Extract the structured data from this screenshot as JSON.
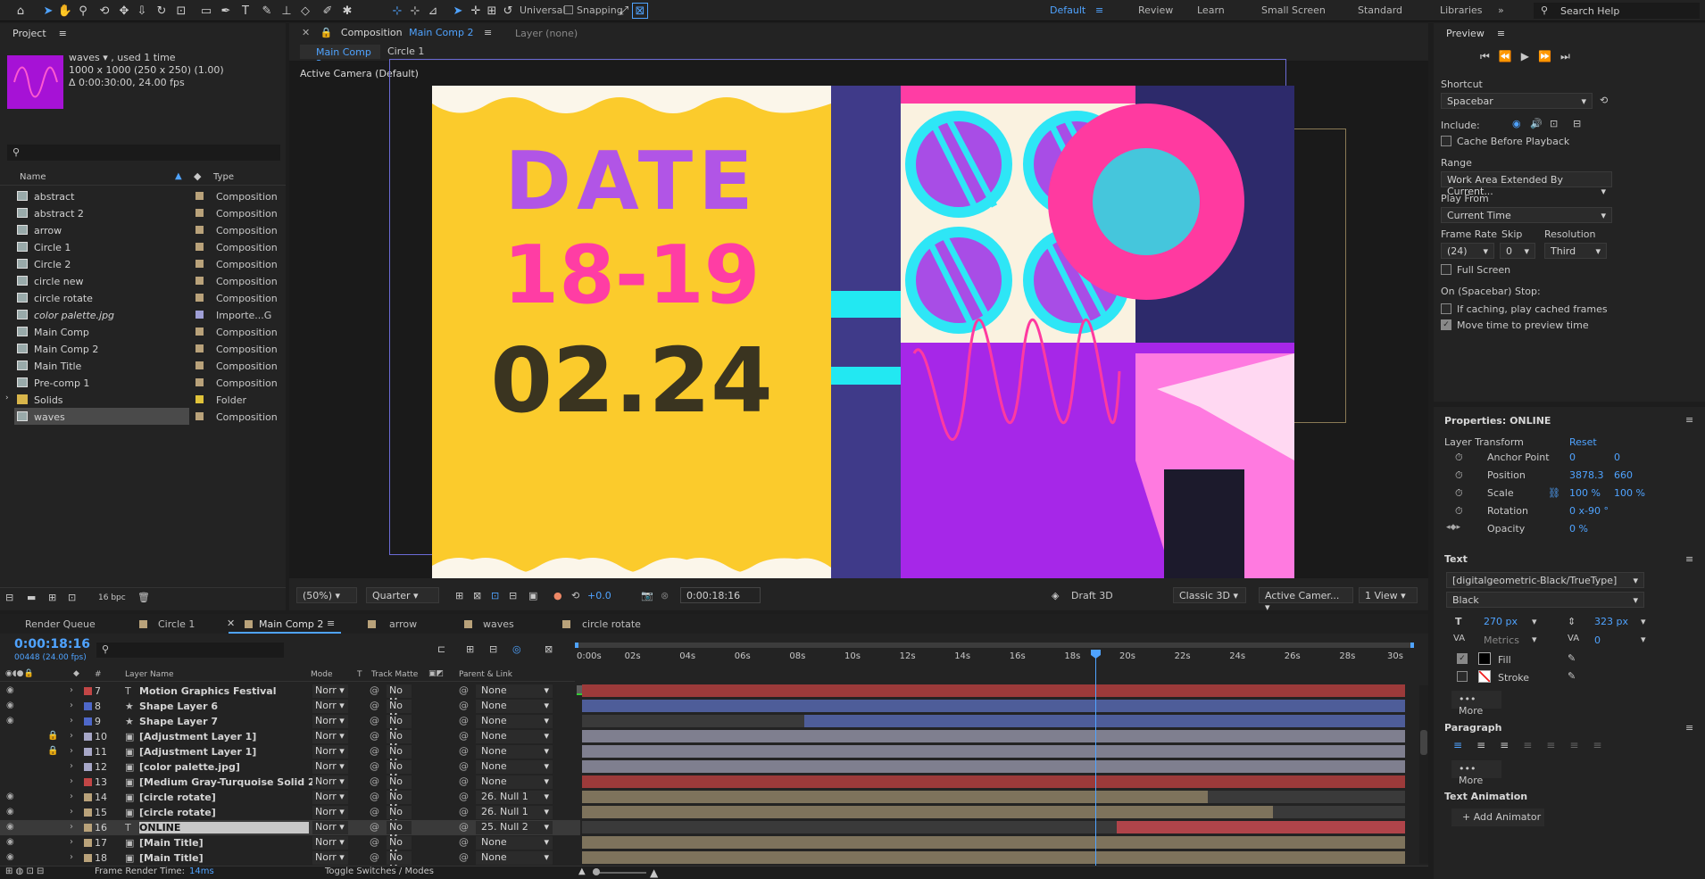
{
  "toolbar": {
    "universal": "Universal",
    "snapping": "Snapping"
  },
  "workspaces": {
    "default": "Default",
    "review": "Review",
    "learn": "Learn",
    "small_screen": "Small Screen",
    "standard": "Standard",
    "libraries": "Libraries",
    "search": "Search Help"
  },
  "project": {
    "title": "Project",
    "item_name": "waves ▾ , used 1 time",
    "item_dims": "1000 x 1000  (250 x 250) (1.00)",
    "item_dur": "Δ 0:00:30:00, 24.00 fps",
    "col_name": "Name",
    "col_type": "Type",
    "items": [
      {
        "name": "abstract",
        "type": "Composition"
      },
      {
        "name": "abstract 2",
        "type": "Composition"
      },
      {
        "name": "arrow",
        "type": "Composition"
      },
      {
        "name": "Circle 1",
        "type": "Composition"
      },
      {
        "name": "Circle 2",
        "type": "Composition"
      },
      {
        "name": "circle new",
        "type": "Composition"
      },
      {
        "name": "circle rotate",
        "type": "Composition"
      },
      {
        "name": "color palette.jpg",
        "type": "Importe...G"
      },
      {
        "name": "Main Comp",
        "type": "Composition"
      },
      {
        "name": "Main Comp 2",
        "type": "Composition"
      },
      {
        "name": "Main Title",
        "type": "Composition"
      },
      {
        "name": "Pre-comp 1",
        "type": "Composition"
      },
      {
        "name": "Solids",
        "type": "Folder"
      },
      {
        "name": "waves",
        "type": "Composition"
      }
    ],
    "bpc": "16 bpc"
  },
  "comp": {
    "tab_prefix": "Composition",
    "tab_name": "Main Comp 2",
    "layer_tab": "Layer (none)",
    "sub1": "Main Comp 2",
    "sub2": "Circle 1",
    "camera_label": "Active Camera (Default)",
    "art": {
      "date": "DATE",
      "days": "18-19",
      "month": "02.24"
    },
    "footer": {
      "zoom": "(50%)",
      "quality": "Quarter",
      "time": "0:00:18:16",
      "offset": "+0.0",
      "renderer": "Draft 3D",
      "classic": "Classic 3D",
      "camera": "Active Camer...",
      "view": "1 View"
    }
  },
  "timeline": {
    "tabs": [
      "Render Queue",
      "Circle 1",
      "Main Comp 2",
      "arrow",
      "waves",
      "circle rotate"
    ],
    "time": "0:00:18:16",
    "frames": "00448 (24.00 fps)",
    "col_layer": "Layer Name",
    "col_mode": "Mode",
    "col_t": "T",
    "col_matte": "Track Matte",
    "col_parent": "Parent & Link",
    "ruler": [
      "0:00s",
      "02s",
      "04s",
      "06s",
      "08s",
      "10s",
      "12s",
      "14s",
      "16s",
      "18s",
      "20s",
      "22s",
      "24s",
      "26s",
      "28s",
      "30s"
    ],
    "layers": [
      {
        "num": "7",
        "name": "Motion Graphics Festival",
        "mode": "Norr",
        "matte": "No M",
        "parent": "None",
        "color": "#c24646"
      },
      {
        "num": "8",
        "name": "Shape Layer 6",
        "mode": "Norr",
        "matte": "No M",
        "parent": "None",
        "color": "#4e68c9"
      },
      {
        "num": "9",
        "name": "Shape Layer 7",
        "mode": "Norr",
        "matte": "No M",
        "parent": "None",
        "color": "#4e68c9"
      },
      {
        "num": "10",
        "name": "[Adjustment Layer 1]",
        "mode": "Norr",
        "matte": "No M",
        "parent": "None",
        "color": "#a7a7c7"
      },
      {
        "num": "11",
        "name": "[Adjustment Layer 1]",
        "mode": "Norr",
        "matte": "No M",
        "parent": "None",
        "color": "#a7a7c7"
      },
      {
        "num": "12",
        "name": "[color palette.jpg]",
        "mode": "Norr",
        "matte": "No M",
        "parent": "None",
        "color": "#a7a7c7"
      },
      {
        "num": "13",
        "name": "[Medium Gray-Turquoise Solid 2]",
        "mode": "Norr",
        "matte": "No M",
        "parent": "None",
        "color": "#c24646"
      },
      {
        "num": "14",
        "name": "[circle rotate]",
        "mode": "Norr",
        "matte": "No M",
        "parent": "26. Null 1",
        "color": "#b9a27a"
      },
      {
        "num": "15",
        "name": "[circle rotate]",
        "mode": "Norr",
        "matte": "No M",
        "parent": "26. Null 1",
        "color": "#b9a27a"
      },
      {
        "num": "16",
        "name": "ONLINE",
        "mode": "Norr",
        "matte": "No M",
        "parent": "25. Null 2",
        "color": "#b9a27a"
      },
      {
        "num": "17",
        "name": "[Main Title]",
        "mode": "Norr",
        "matte": "No M",
        "parent": "None",
        "color": "#b9a27a"
      },
      {
        "num": "18",
        "name": "[Main Title]",
        "mode": "Norr",
        "matte": "No M",
        "parent": "None",
        "color": "#b9a27a"
      }
    ],
    "render_time_label": "Frame Render Time:",
    "render_time": "14ms",
    "toggle": "Toggle Switches / Modes"
  },
  "preview": {
    "title": "Preview",
    "shortcut": "Shortcut",
    "shortcut_val": "Spacebar",
    "include": "Include:",
    "cache": "Cache Before Playback",
    "range": "Range",
    "range_val": "Work Area Extended By Current...",
    "play_from": "Play From",
    "play_from_val": "Current Time",
    "frame_rate": "Frame Rate",
    "skip": "Skip",
    "resolution": "Resolution",
    "fr_val": "(24)",
    "skip_val": "0",
    "res_val": "Third",
    "full_screen": "Full Screen",
    "on_stop": "On (Spacebar) Stop:",
    "if_caching": "If caching, play cached frames",
    "move_time": "Move time to preview time"
  },
  "properties": {
    "title": "Properties: ONLINE",
    "transform": "Layer Transform",
    "reset": "Reset",
    "anchor": "Anchor Point",
    "anchor_x": "0",
    "anchor_y": "0",
    "position": "Position",
    "pos_x": "3878.3",
    "pos_y": "660",
    "scale": "Scale",
    "scale_x": "100 %",
    "scale_y": "100 %",
    "rotation": "Rotation",
    "rot": "0 x-90 °",
    "opacity": "Opacity",
    "op": "0 %",
    "text": "Text",
    "font": "[digitalgeometric-Black/TrueType]",
    "style": "Black",
    "size": "270 px",
    "leading": "323 px",
    "kerning": "Metrics",
    "tracking": "0",
    "fill": "Fill",
    "stroke": "Stroke",
    "more": "More",
    "paragraph": "Paragraph",
    "more2": "More",
    "text_anim": "Text Animation",
    "add_anim": "Add Animator"
  }
}
